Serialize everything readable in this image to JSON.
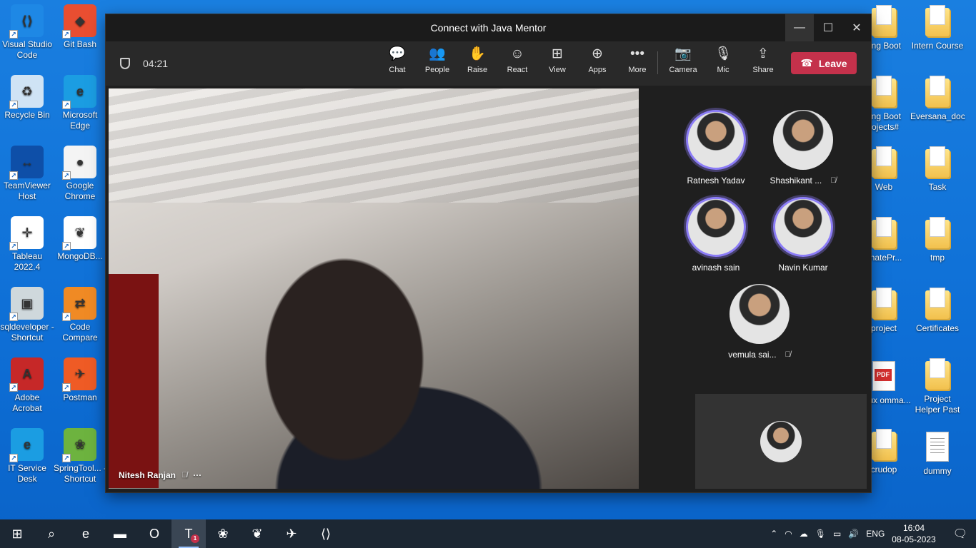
{
  "desktop_left": [
    {
      "label": "Visual Studio Code",
      "icon": "vscode-icon",
      "bg": "#1e88e5",
      "glyph": "⟨⟩"
    },
    {
      "label": "Git Bash",
      "icon": "git-bash-icon",
      "bg": "#e94e31",
      "glyph": "◆"
    },
    {
      "label": "Recycle Bin",
      "icon": "recycle-bin-icon",
      "bg": "#cfe3f5",
      "glyph": "♻"
    },
    {
      "label": "Microsoft Edge",
      "icon": "edge-icon",
      "bg": "#1b9de2",
      "glyph": "e"
    },
    {
      "label": "TeamViewer Host",
      "icon": "teamviewer-icon",
      "bg": "#0e4fa8",
      "glyph": "↔"
    },
    {
      "label": "Google Chrome",
      "icon": "chrome-icon",
      "bg": "#f4f4f4",
      "glyph": "●"
    },
    {
      "label": "Tableau 2022.4",
      "icon": "tableau-icon",
      "bg": "#ffffff",
      "glyph": "✛"
    },
    {
      "label": "MongoDB...",
      "icon": "mongodb-icon",
      "bg": "#ffffff",
      "glyph": "❦"
    },
    {
      "label": "sqldeveloper - Shortcut",
      "icon": "sqldeveloper-icon",
      "bg": "#cfd8dc",
      "glyph": "▣"
    },
    {
      "label": "Code Compare",
      "icon": "code-compare-icon",
      "bg": "#f08a24",
      "glyph": "⇄"
    },
    {
      "label": "Adobe Acrobat",
      "icon": "acrobat-icon",
      "bg": "#c62828",
      "glyph": "A"
    },
    {
      "label": "Postman",
      "icon": "postman-icon",
      "bg": "#ef5b25",
      "glyph": "✈"
    },
    {
      "label": "IT Service Desk",
      "icon": "edge-icon",
      "bg": "#1b9de2",
      "glyph": "e"
    },
    {
      "label": "SpringTool... - Shortcut",
      "icon": "spring-icon",
      "bg": "#6db33f",
      "glyph": "❀"
    }
  ],
  "desktop_right": [
    {
      "label": "ring Boot",
      "icon": "folder-icon",
      "type": "folder"
    },
    {
      "label": "Intern Course",
      "icon": "folder-icon",
      "type": "folder"
    },
    {
      "label": "ring Boot rojects#",
      "icon": "folder-icon",
      "type": "folder"
    },
    {
      "label": "Eversana_doc",
      "icon": "folder-icon",
      "type": "folder"
    },
    {
      "label": "Web",
      "icon": "folder-icon",
      "type": "folder"
    },
    {
      "label": "Task",
      "icon": "folder-icon",
      "type": "folder"
    },
    {
      "label": "imatePr...",
      "icon": "folder-icon",
      "type": "folder"
    },
    {
      "label": "tmp",
      "icon": "folder-icon",
      "type": "folder"
    },
    {
      "label": "project",
      "icon": "folder-icon",
      "type": "folder"
    },
    {
      "label": "Certificates",
      "icon": "folder-icon",
      "type": "folder"
    },
    {
      "label": "Linux omma...",
      "icon": "pdf-file-icon",
      "type": "pdf"
    },
    {
      "label": "Project Helper Past",
      "icon": "folder-icon",
      "type": "folder"
    },
    {
      "label": "crudop",
      "icon": "folder-icon",
      "type": "folder"
    },
    {
      "label": "dummy",
      "icon": "text-file-icon",
      "type": "doc"
    }
  ],
  "window": {
    "title": "Connect with Java Mentor",
    "timer": "04:21",
    "tools": [
      {
        "label": "Chat",
        "glyph": "💬",
        "name": "chat"
      },
      {
        "label": "People",
        "glyph": "👥",
        "name": "people"
      },
      {
        "label": "Raise",
        "glyph": "✋",
        "name": "raise-hand"
      },
      {
        "label": "React",
        "glyph": "☺",
        "name": "react"
      },
      {
        "label": "View",
        "glyph": "⊞",
        "name": "view"
      },
      {
        "label": "Apps",
        "glyph": "⊕",
        "name": "apps"
      },
      {
        "label": "More",
        "glyph": "•••",
        "name": "more"
      }
    ],
    "device_tools": [
      {
        "label": "Camera",
        "glyph": "📷",
        "name": "camera"
      },
      {
        "label": "Mic",
        "glyph": "🎙",
        "name": "mic"
      },
      {
        "label": "Share",
        "glyph": "⇪",
        "name": "share"
      }
    ],
    "leave_label": "Leave",
    "leave_color": "#c4314b",
    "main_speaker": "Nitesh Ranjan",
    "main_more": "···"
  },
  "participants": [
    {
      "name": "Ratnesh Yadav",
      "muted": false,
      "ring": true
    },
    {
      "name": "Shashikant ...",
      "muted": true,
      "ring": false
    },
    {
      "name": "avinash sain",
      "muted": false,
      "ring": true
    },
    {
      "name": "Navin Kumar",
      "muted": false,
      "ring": true
    },
    {
      "name": "vemula sai...",
      "muted": true,
      "ring": false
    }
  ],
  "taskbar": {
    "apps": [
      {
        "name": "start-button",
        "glyph": "⊞"
      },
      {
        "name": "search-icon",
        "glyph": "⌕"
      },
      {
        "name": "edge-icon",
        "glyph": "e"
      },
      {
        "name": "file-explorer-icon",
        "glyph": "▬"
      },
      {
        "name": "outlook-icon",
        "glyph": "O"
      },
      {
        "name": "teams-icon",
        "glyph": "T",
        "badge": "1",
        "active": true
      },
      {
        "name": "spring-icon",
        "glyph": "❀"
      },
      {
        "name": "mongodb-icon",
        "glyph": "❦"
      },
      {
        "name": "postman-icon",
        "glyph": "✈"
      },
      {
        "name": "vscode-icon",
        "glyph": "⟨⟩"
      }
    ],
    "language": "ENG",
    "time": "16:04",
    "date": "08-05-2023"
  }
}
